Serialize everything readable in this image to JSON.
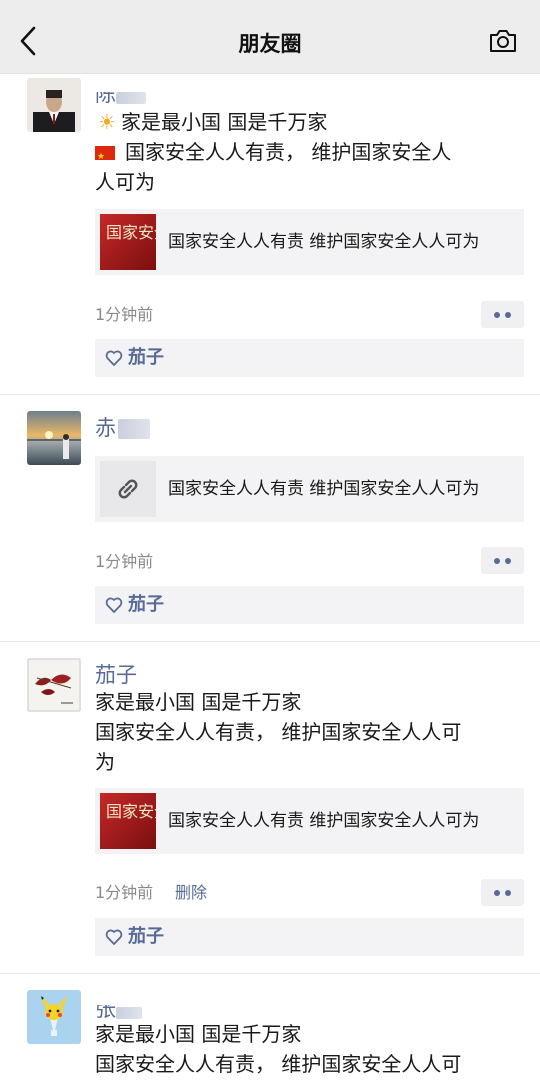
{
  "header": {
    "title": "朋友圈",
    "back_icon": "chevron-left-icon",
    "camera_icon": "camera-icon"
  },
  "posts": [
    {
      "author": "陈",
      "lines": [
        {
          "emoji": "☀",
          "text": "家是最小国  国是千万家"
        },
        {
          "flag": true,
          "text": "国家安全人人有责，  维护国家安全人"
        },
        {
          "text": "人可为"
        }
      ],
      "card_title": "国家安全人人有责  维护国家安全人人可为",
      "card_thumb_text": "国家安全",
      "time": "1分钟前",
      "likes": "茄子"
    },
    {
      "author": "赤",
      "lines": [],
      "card_title": "国家安全人人有责  维护国家安全人人可为",
      "card_icon": "link-icon",
      "time": "1分钟前",
      "likes": "茄子"
    },
    {
      "author": "茄子",
      "lines": [
        {
          "text": "家是最小国  国是千万家"
        },
        {
          "text": "国家安全人人有责，  维护国家安全人人可"
        },
        {
          "text": "为"
        }
      ],
      "card_title": "国家安全人人有责  维护国家安全人人可为",
      "card_thumb_text": "国家安全",
      "time": "1分钟前",
      "delete_label": "删除",
      "likes": "茄子"
    },
    {
      "author": "张",
      "lines": [
        {
          "text": "家是最小国  国是千万家"
        },
        {
          "text": "国家安全人人有责，  维护国家安全人人可"
        }
      ]
    }
  ],
  "colors": {
    "link_blue": "#576b95",
    "topbar_bg": "#ededed",
    "card_bg": "#f3f3f5"
  }
}
